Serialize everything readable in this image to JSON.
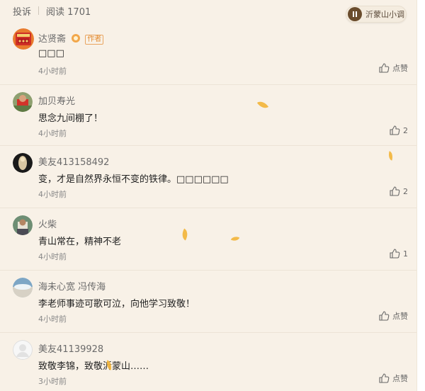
{
  "toolbar": {
    "report_label": "投诉",
    "reads_label": "阅读 1701"
  },
  "music_player": {
    "track_title": "沂蒙山小调",
    "state": "playing",
    "icon": "pause-icon"
  },
  "comments": [
    {
      "name": "达贤斋",
      "badge": "作者",
      "content": "□□□",
      "time": "4小时前",
      "like_label": "点赞"
    },
    {
      "name": "加贝寿光",
      "content": "思念九间棚了！",
      "time": "4小时前",
      "like_label": "2"
    },
    {
      "name": "美友413158492",
      "content": "变，才是自然界永恒不变的铁律。□□□□□□",
      "time": "4小时前",
      "like_label": "2"
    },
    {
      "name": "火柴",
      "content": "青山常在，精神不老",
      "time": "4小时前",
      "like_label": "1"
    },
    {
      "name": "海未心宽 冯传海",
      "content": "李老师事迹可歌可泣，向他学习致敬！",
      "time": "4小时前",
      "like_label": "点赞"
    },
    {
      "name": "美友41139928",
      "content": "致敬李锦，致敬沂蒙山……",
      "time": "3小时前",
      "like_label": "点赞"
    }
  ],
  "colors": {
    "page_background": "#f8f1e7",
    "author_badge": "#e48b2f",
    "leaf": "#f2b53c"
  }
}
